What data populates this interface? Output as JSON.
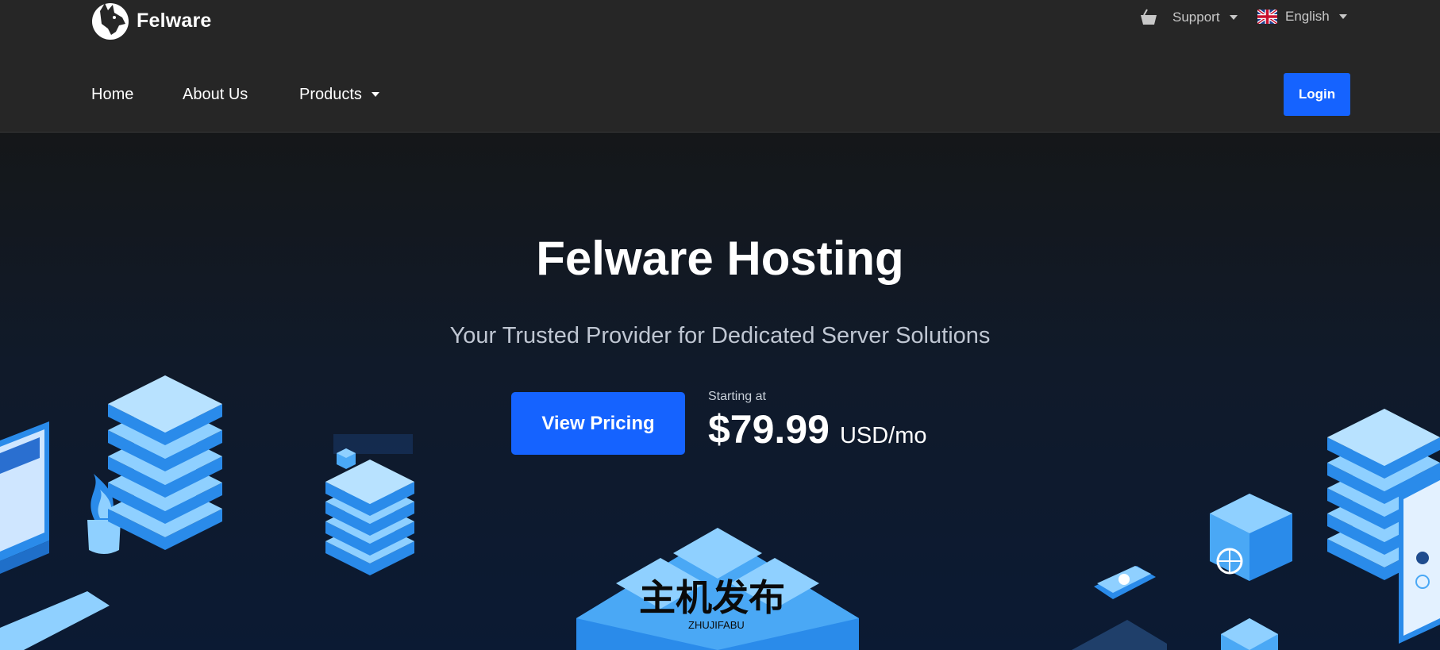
{
  "brand": {
    "name": "Felware"
  },
  "utility_nav": {
    "support_label": "Support",
    "language_label": "English"
  },
  "main_nav": {
    "items": [
      "Home",
      "About Us",
      "Products"
    ],
    "login_label": "Login"
  },
  "hero": {
    "title": "Felware Hosting",
    "subtitle": "Your Trusted Provider for Dedicated Server Solutions",
    "cta_label": "View Pricing",
    "starting_label": "Starting at",
    "price": "$79.99",
    "price_unit": "USD/mo"
  },
  "watermark": {
    "main": "主机发布",
    "sub": "ZHUJIFABU"
  },
  "colors": {
    "accent": "#1563ff",
    "header_bg": "#262626",
    "hero_bg_top": "#151719",
    "hero_bg_bottom": "#0b1a33",
    "iso_light": "#8fd0ff",
    "iso_mid": "#4aa8f5",
    "iso_dark": "#1f7fd6"
  },
  "icons": {
    "logo": "wolf-head-logo",
    "support": "basket-icon",
    "language": "uk-flag-icon",
    "dropdown": "caret-down-icon"
  }
}
